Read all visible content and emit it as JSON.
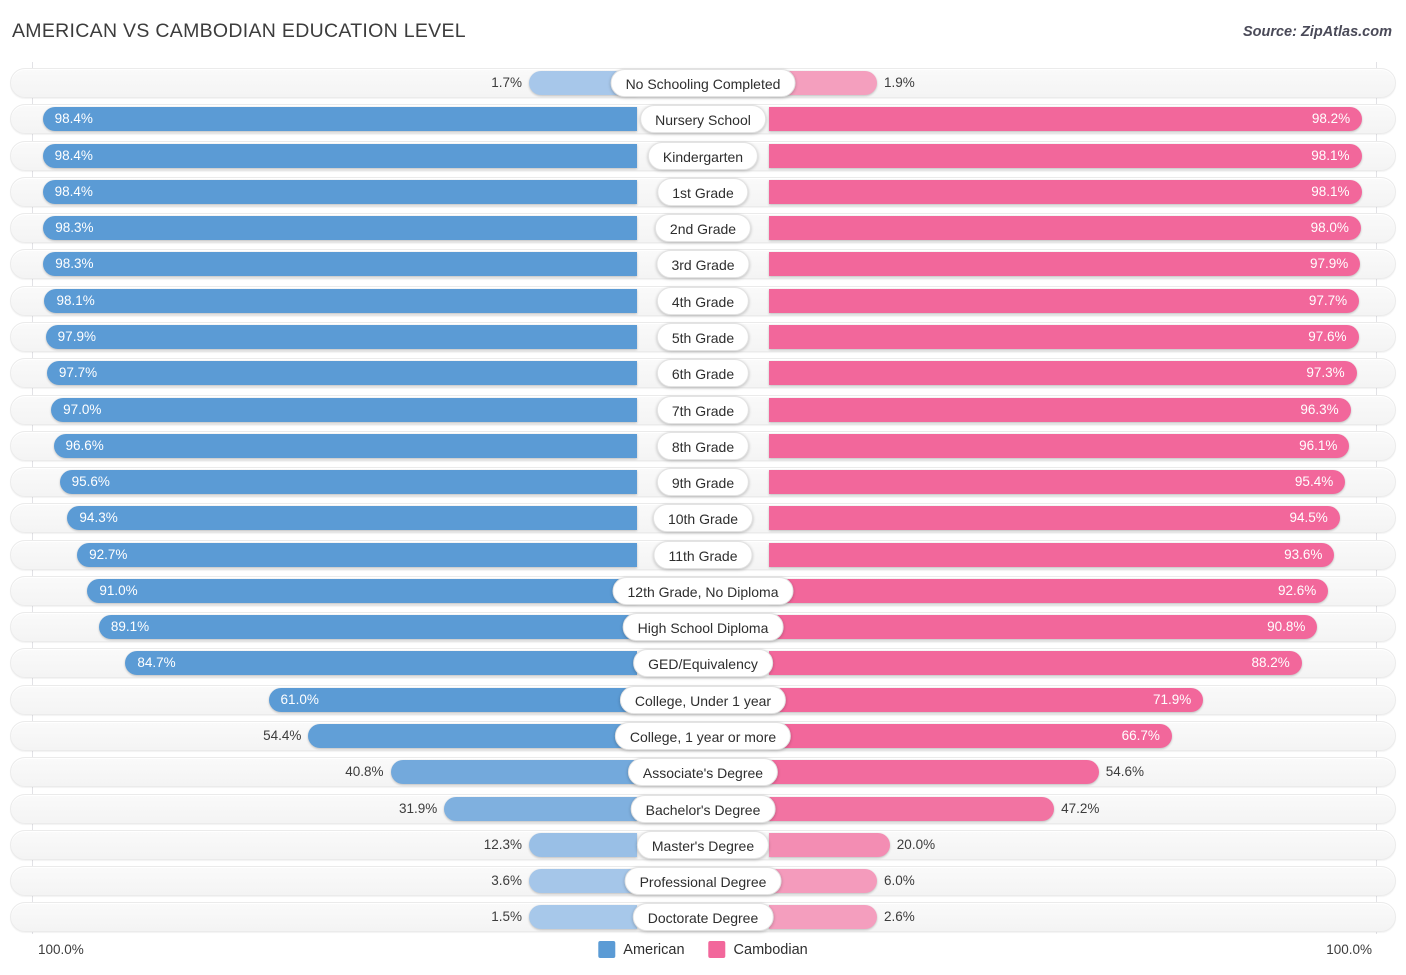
{
  "header": {
    "title": "AMERICAN VS CAMBODIAN EDUCATION LEVEL",
    "source": "Source: ZipAtlas.com"
  },
  "colors": {
    "american": "#5b9bd5",
    "cambodian": "#f2679b",
    "american_light": "#a8c8ea",
    "cambodian_light": "#f4a0bf",
    "track": "#f6f6f6",
    "text": "#3c3c3c"
  },
  "axis": {
    "left_label": "100.0%",
    "right_label": "100.0%",
    "max": 100
  },
  "legend": {
    "items": [
      {
        "label": "American",
        "color": "#5b9bd5"
      },
      {
        "label": "Cambodian",
        "color": "#f2679b"
      }
    ]
  },
  "chart_data": {
    "type": "bar",
    "orientation": "horizontal-diverging",
    "title": "AMERICAN VS CAMBODIAN EDUCATION LEVEL",
    "xlabel": "",
    "ylabel": "",
    "xlim": [
      0,
      100
    ],
    "grid": false,
    "legend_position": "bottom-center",
    "categories": [
      "No Schooling Completed",
      "Nursery School",
      "Kindergarten",
      "1st Grade",
      "2nd Grade",
      "3rd Grade",
      "4th Grade",
      "5th Grade",
      "6th Grade",
      "7th Grade",
      "8th Grade",
      "9th Grade",
      "10th Grade",
      "11th Grade",
      "12th Grade, No Diploma",
      "High School Diploma",
      "GED/Equivalency",
      "College, Under 1 year",
      "College, 1 year or more",
      "Associate's Degree",
      "Bachelor's Degree",
      "Master's Degree",
      "Professional Degree",
      "Doctorate Degree"
    ],
    "series": [
      {
        "name": "American",
        "color": "#5b9bd5",
        "values": [
          1.7,
          98.4,
          98.4,
          98.4,
          98.3,
          98.3,
          98.1,
          97.9,
          97.7,
          97.0,
          96.6,
          95.6,
          94.3,
          92.7,
          91.0,
          89.1,
          84.7,
          61.0,
          54.4,
          40.8,
          31.9,
          12.3,
          3.6,
          1.5
        ],
        "labels": [
          "1.7%",
          "98.4%",
          "98.4%",
          "98.4%",
          "98.3%",
          "98.3%",
          "98.1%",
          "97.9%",
          "97.7%",
          "97.0%",
          "96.6%",
          "95.6%",
          "94.3%",
          "92.7%",
          "91.0%",
          "89.1%",
          "84.7%",
          "61.0%",
          "54.4%",
          "40.8%",
          "31.9%",
          "12.3%",
          "3.6%",
          "1.5%"
        ]
      },
      {
        "name": "Cambodian",
        "color": "#f2679b",
        "values": [
          1.9,
          98.2,
          98.1,
          98.1,
          98.0,
          97.9,
          97.7,
          97.6,
          97.3,
          96.3,
          96.1,
          95.4,
          94.5,
          93.6,
          92.6,
          90.8,
          88.2,
          71.9,
          66.7,
          54.6,
          47.2,
          20.0,
          6.0,
          2.6
        ],
        "labels": [
          "1.9%",
          "98.2%",
          "98.1%",
          "98.1%",
          "98.0%",
          "97.9%",
          "97.7%",
          "97.6%",
          "97.3%",
          "96.3%",
          "96.1%",
          "95.4%",
          "94.5%",
          "93.6%",
          "92.6%",
          "90.8%",
          "88.2%",
          "71.9%",
          "66.7%",
          "54.6%",
          "47.2%",
          "20.0%",
          "6.0%",
          "2.6%"
        ]
      }
    ]
  }
}
